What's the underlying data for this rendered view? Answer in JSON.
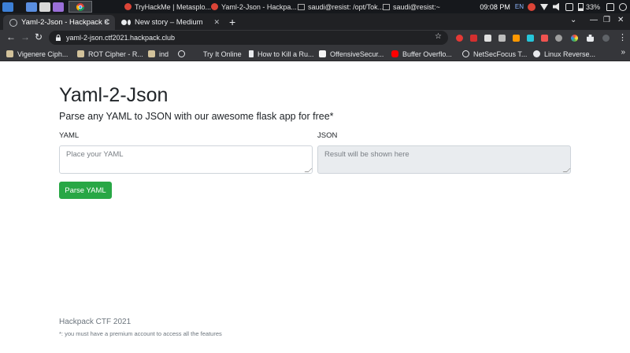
{
  "taskbar": {
    "tasks": [
      "TryHackMe | Metasplo...",
      "Yaml-2-Json - Hackpa...",
      "saudi@resist: /opt/Tok...",
      "saudi@resist:~"
    ],
    "clock": "09:08 PM",
    "lang": "EN",
    "battery": "33%"
  },
  "tabs": [
    {
      "title": "Yaml-2-Json - Hackpack C",
      "favicon": "globe-icon",
      "active": true
    },
    {
      "title": "New story – Medium",
      "favicon": "medium-icon",
      "active": false
    }
  ],
  "omnibox": {
    "url": "yaml-2-json.ctf2021.hackpack.club"
  },
  "bookmarks": [
    {
      "label": "Vigenere Ciph...",
      "icon": "folder-icon"
    },
    {
      "label": "ROT Cipher - R...",
      "icon": "folder-icon"
    },
    {
      "label": "ind",
      "icon": "folder-icon"
    },
    {
      "label": "",
      "icon": "globe-icon"
    },
    {
      "label": "Try It Online",
      "icon": "none"
    },
    {
      "label": "How to Kill a Ru...",
      "icon": "lock-icon"
    },
    {
      "label": "OffensiveSecur...",
      "icon": "offsec-icon"
    },
    {
      "label": "Buffer Overflo...",
      "icon": "youtube-icon"
    },
    {
      "label": "NetSecFocus T...",
      "icon": "globe-icon"
    },
    {
      "label": "Linux Reverse...",
      "icon": "medium-icon"
    }
  ],
  "page": {
    "title": "Yaml-2-Json",
    "subtitle": "Parse any YAML to JSON with our awesome flask app for free*",
    "yaml_label": "YAML",
    "yaml_placeholder": "Place your YAML",
    "json_label": "JSON",
    "json_placeholder": "Result will be shown here",
    "button_label": "Parse YAML",
    "footer_title": "Hackpack CTF 2021",
    "footer_note": "*: you must have a premium account to access all the features"
  },
  "colors": {
    "button_bg": "#28a745",
    "taskbar_bg": "#16181c",
    "browser_chrome": "#35363a",
    "tab_strip": "#202124",
    "readonly_bg": "#e9ecef"
  }
}
